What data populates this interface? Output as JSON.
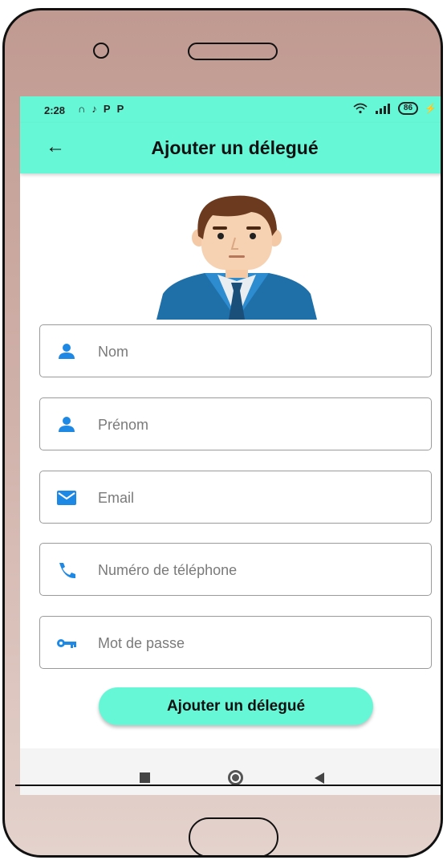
{
  "status_bar": {
    "time": "2:28",
    "icons": [
      "headphones-icon",
      "tiktok-icon",
      "p-icon",
      "p-icon"
    ],
    "battery": "86"
  },
  "app_bar": {
    "title": "Ajouter un délegué"
  },
  "form": {
    "fields": [
      {
        "icon": "person-icon",
        "placeholder": "Nom"
      },
      {
        "icon": "person-icon",
        "placeholder": "Prénom"
      },
      {
        "icon": "email-icon",
        "placeholder": "Email"
      },
      {
        "icon": "phone-icon",
        "placeholder": "Numéro de téléphone"
      },
      {
        "icon": "key-icon",
        "placeholder": "Mot de passe"
      }
    ],
    "submit_label": "Ajouter un délegué"
  },
  "colors": {
    "accent": "#66f7d7",
    "icon_blue": "#1e88e5",
    "device_frame": "#c09a91"
  }
}
